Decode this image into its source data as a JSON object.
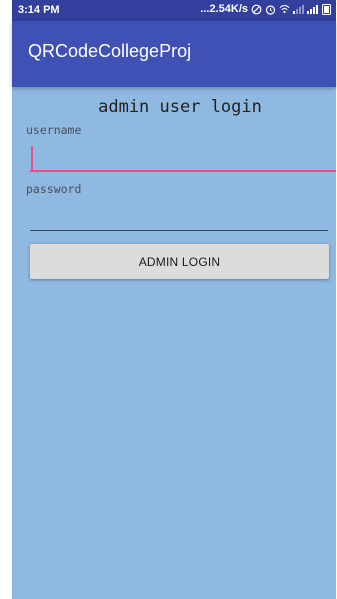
{
  "status_bar": {
    "time": "3:14 PM",
    "network_speed": "...2.54K/s",
    "icons": [
      "no-disturb-icon",
      "alarm-icon",
      "wifi-icon",
      "signal-weak-icon",
      "signal-icon",
      "battery-icon"
    ]
  },
  "app_bar": {
    "title": "QRCodeCollegeProj"
  },
  "login": {
    "title": "admin user login",
    "username_label": "username",
    "username_value": "",
    "password_label": "password",
    "password_value": "",
    "button_label": "ADMIN LOGIN"
  },
  "colors": {
    "status_bar": "#333f9c",
    "app_bar": "#3f51b5",
    "background": "#8fb9e1",
    "accent": "#e4508a",
    "button": "#dcdcdc"
  }
}
